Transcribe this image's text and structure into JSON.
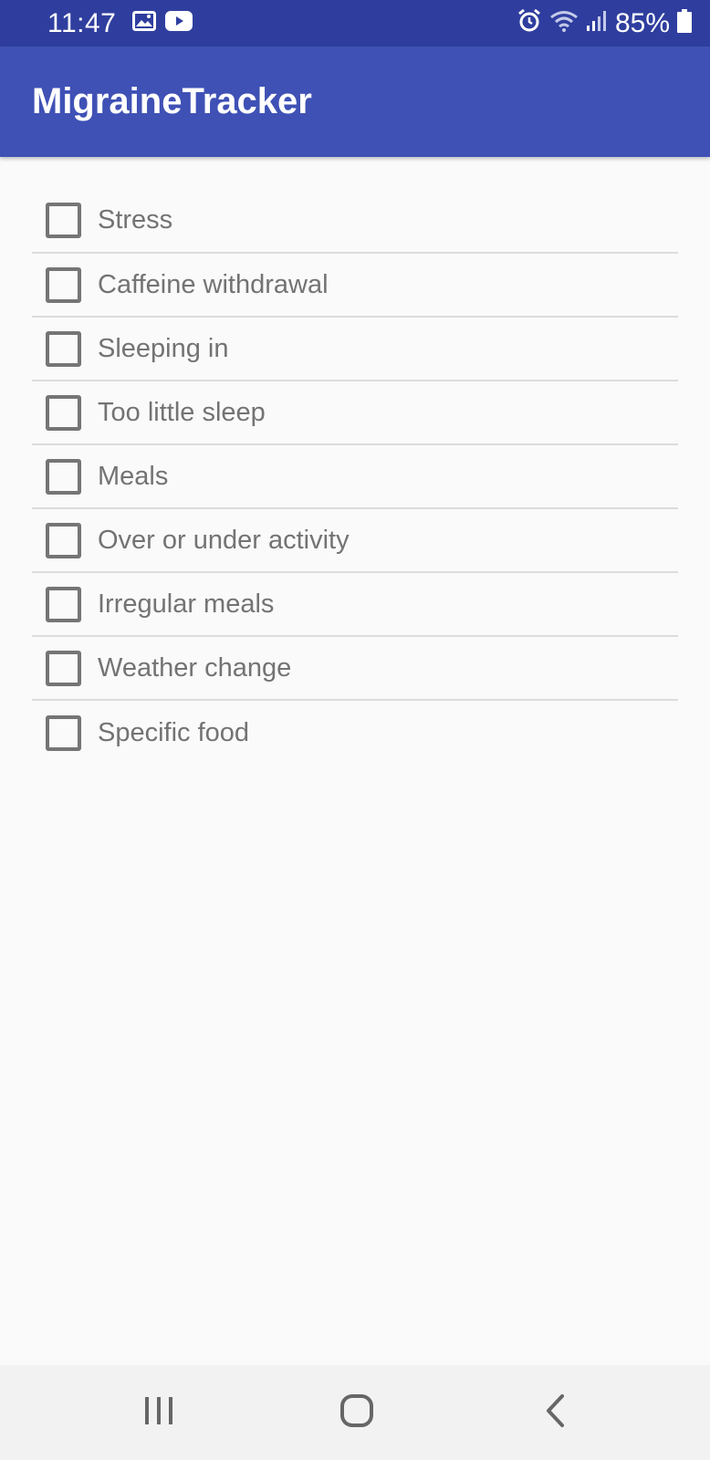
{
  "status_bar": {
    "time": "11:47",
    "battery": "85%",
    "icons": [
      "image-icon",
      "youtube-icon",
      "alarm-icon",
      "wifi-icon",
      "signal-icon",
      "battery-icon"
    ]
  },
  "app_bar": {
    "title": "MigraineTracker"
  },
  "triggers": [
    {
      "label": "Stress",
      "checked": false
    },
    {
      "label": "Caffeine withdrawal",
      "checked": false
    },
    {
      "label": "Sleeping in",
      "checked": false
    },
    {
      "label": "Too little sleep",
      "checked": false
    },
    {
      "label": "Meals",
      "checked": false
    },
    {
      "label": "Over or under activity",
      "checked": false
    },
    {
      "label": "Irregular meals",
      "checked": false
    },
    {
      "label": "Weather change",
      "checked": false
    },
    {
      "label": "Specific food",
      "checked": false
    }
  ],
  "nav_bar": {
    "icons": [
      "recent-apps-icon",
      "home-icon",
      "back-icon"
    ]
  },
  "colors": {
    "status_bar": "#2f3e9e",
    "app_bar": "#3f51b5",
    "background": "#fafafa",
    "checkbox_border": "#757575",
    "text": "#737373"
  }
}
